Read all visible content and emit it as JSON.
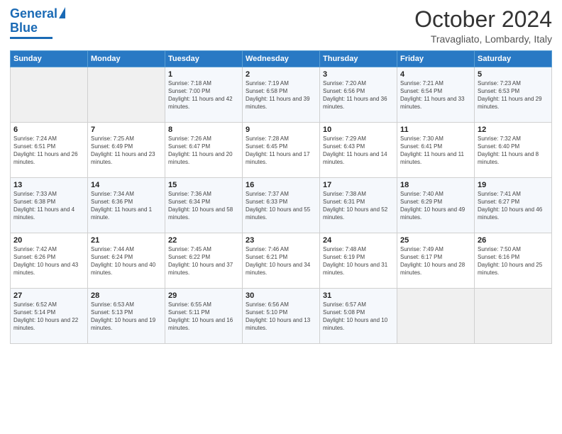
{
  "logo": {
    "text_general": "General",
    "text_blue": "Blue"
  },
  "title": "October 2024",
  "location": "Travagliato, Lombardy, Italy",
  "weekdays": [
    "Sunday",
    "Monday",
    "Tuesday",
    "Wednesday",
    "Thursday",
    "Friday",
    "Saturday"
  ],
  "weeks": [
    [
      {
        "day": "",
        "info": ""
      },
      {
        "day": "",
        "info": ""
      },
      {
        "day": "1",
        "info": "Sunrise: 7:18 AM\nSunset: 7:00 PM\nDaylight: 11 hours and 42 minutes."
      },
      {
        "day": "2",
        "info": "Sunrise: 7:19 AM\nSunset: 6:58 PM\nDaylight: 11 hours and 39 minutes."
      },
      {
        "day": "3",
        "info": "Sunrise: 7:20 AM\nSunset: 6:56 PM\nDaylight: 11 hours and 36 minutes."
      },
      {
        "day": "4",
        "info": "Sunrise: 7:21 AM\nSunset: 6:54 PM\nDaylight: 11 hours and 33 minutes."
      },
      {
        "day": "5",
        "info": "Sunrise: 7:23 AM\nSunset: 6:53 PM\nDaylight: 11 hours and 29 minutes."
      }
    ],
    [
      {
        "day": "6",
        "info": "Sunrise: 7:24 AM\nSunset: 6:51 PM\nDaylight: 11 hours and 26 minutes."
      },
      {
        "day": "7",
        "info": "Sunrise: 7:25 AM\nSunset: 6:49 PM\nDaylight: 11 hours and 23 minutes."
      },
      {
        "day": "8",
        "info": "Sunrise: 7:26 AM\nSunset: 6:47 PM\nDaylight: 11 hours and 20 minutes."
      },
      {
        "day": "9",
        "info": "Sunrise: 7:28 AM\nSunset: 6:45 PM\nDaylight: 11 hours and 17 minutes."
      },
      {
        "day": "10",
        "info": "Sunrise: 7:29 AM\nSunset: 6:43 PM\nDaylight: 11 hours and 14 minutes."
      },
      {
        "day": "11",
        "info": "Sunrise: 7:30 AM\nSunset: 6:41 PM\nDaylight: 11 hours and 11 minutes."
      },
      {
        "day": "12",
        "info": "Sunrise: 7:32 AM\nSunset: 6:40 PM\nDaylight: 11 hours and 8 minutes."
      }
    ],
    [
      {
        "day": "13",
        "info": "Sunrise: 7:33 AM\nSunset: 6:38 PM\nDaylight: 11 hours and 4 minutes."
      },
      {
        "day": "14",
        "info": "Sunrise: 7:34 AM\nSunset: 6:36 PM\nDaylight: 11 hours and 1 minute."
      },
      {
        "day": "15",
        "info": "Sunrise: 7:36 AM\nSunset: 6:34 PM\nDaylight: 10 hours and 58 minutes."
      },
      {
        "day": "16",
        "info": "Sunrise: 7:37 AM\nSunset: 6:33 PM\nDaylight: 10 hours and 55 minutes."
      },
      {
        "day": "17",
        "info": "Sunrise: 7:38 AM\nSunset: 6:31 PM\nDaylight: 10 hours and 52 minutes."
      },
      {
        "day": "18",
        "info": "Sunrise: 7:40 AM\nSunset: 6:29 PM\nDaylight: 10 hours and 49 minutes."
      },
      {
        "day": "19",
        "info": "Sunrise: 7:41 AM\nSunset: 6:27 PM\nDaylight: 10 hours and 46 minutes."
      }
    ],
    [
      {
        "day": "20",
        "info": "Sunrise: 7:42 AM\nSunset: 6:26 PM\nDaylight: 10 hours and 43 minutes."
      },
      {
        "day": "21",
        "info": "Sunrise: 7:44 AM\nSunset: 6:24 PM\nDaylight: 10 hours and 40 minutes."
      },
      {
        "day": "22",
        "info": "Sunrise: 7:45 AM\nSunset: 6:22 PM\nDaylight: 10 hours and 37 minutes."
      },
      {
        "day": "23",
        "info": "Sunrise: 7:46 AM\nSunset: 6:21 PM\nDaylight: 10 hours and 34 minutes."
      },
      {
        "day": "24",
        "info": "Sunrise: 7:48 AM\nSunset: 6:19 PM\nDaylight: 10 hours and 31 minutes."
      },
      {
        "day": "25",
        "info": "Sunrise: 7:49 AM\nSunset: 6:17 PM\nDaylight: 10 hours and 28 minutes."
      },
      {
        "day": "26",
        "info": "Sunrise: 7:50 AM\nSunset: 6:16 PM\nDaylight: 10 hours and 25 minutes."
      }
    ],
    [
      {
        "day": "27",
        "info": "Sunrise: 6:52 AM\nSunset: 5:14 PM\nDaylight: 10 hours and 22 minutes."
      },
      {
        "day": "28",
        "info": "Sunrise: 6:53 AM\nSunset: 5:13 PM\nDaylight: 10 hours and 19 minutes."
      },
      {
        "day": "29",
        "info": "Sunrise: 6:55 AM\nSunset: 5:11 PM\nDaylight: 10 hours and 16 minutes."
      },
      {
        "day": "30",
        "info": "Sunrise: 6:56 AM\nSunset: 5:10 PM\nDaylight: 10 hours and 13 minutes."
      },
      {
        "day": "31",
        "info": "Sunrise: 6:57 AM\nSunset: 5:08 PM\nDaylight: 10 hours and 10 minutes."
      },
      {
        "day": "",
        "info": ""
      },
      {
        "day": "",
        "info": ""
      }
    ]
  ]
}
